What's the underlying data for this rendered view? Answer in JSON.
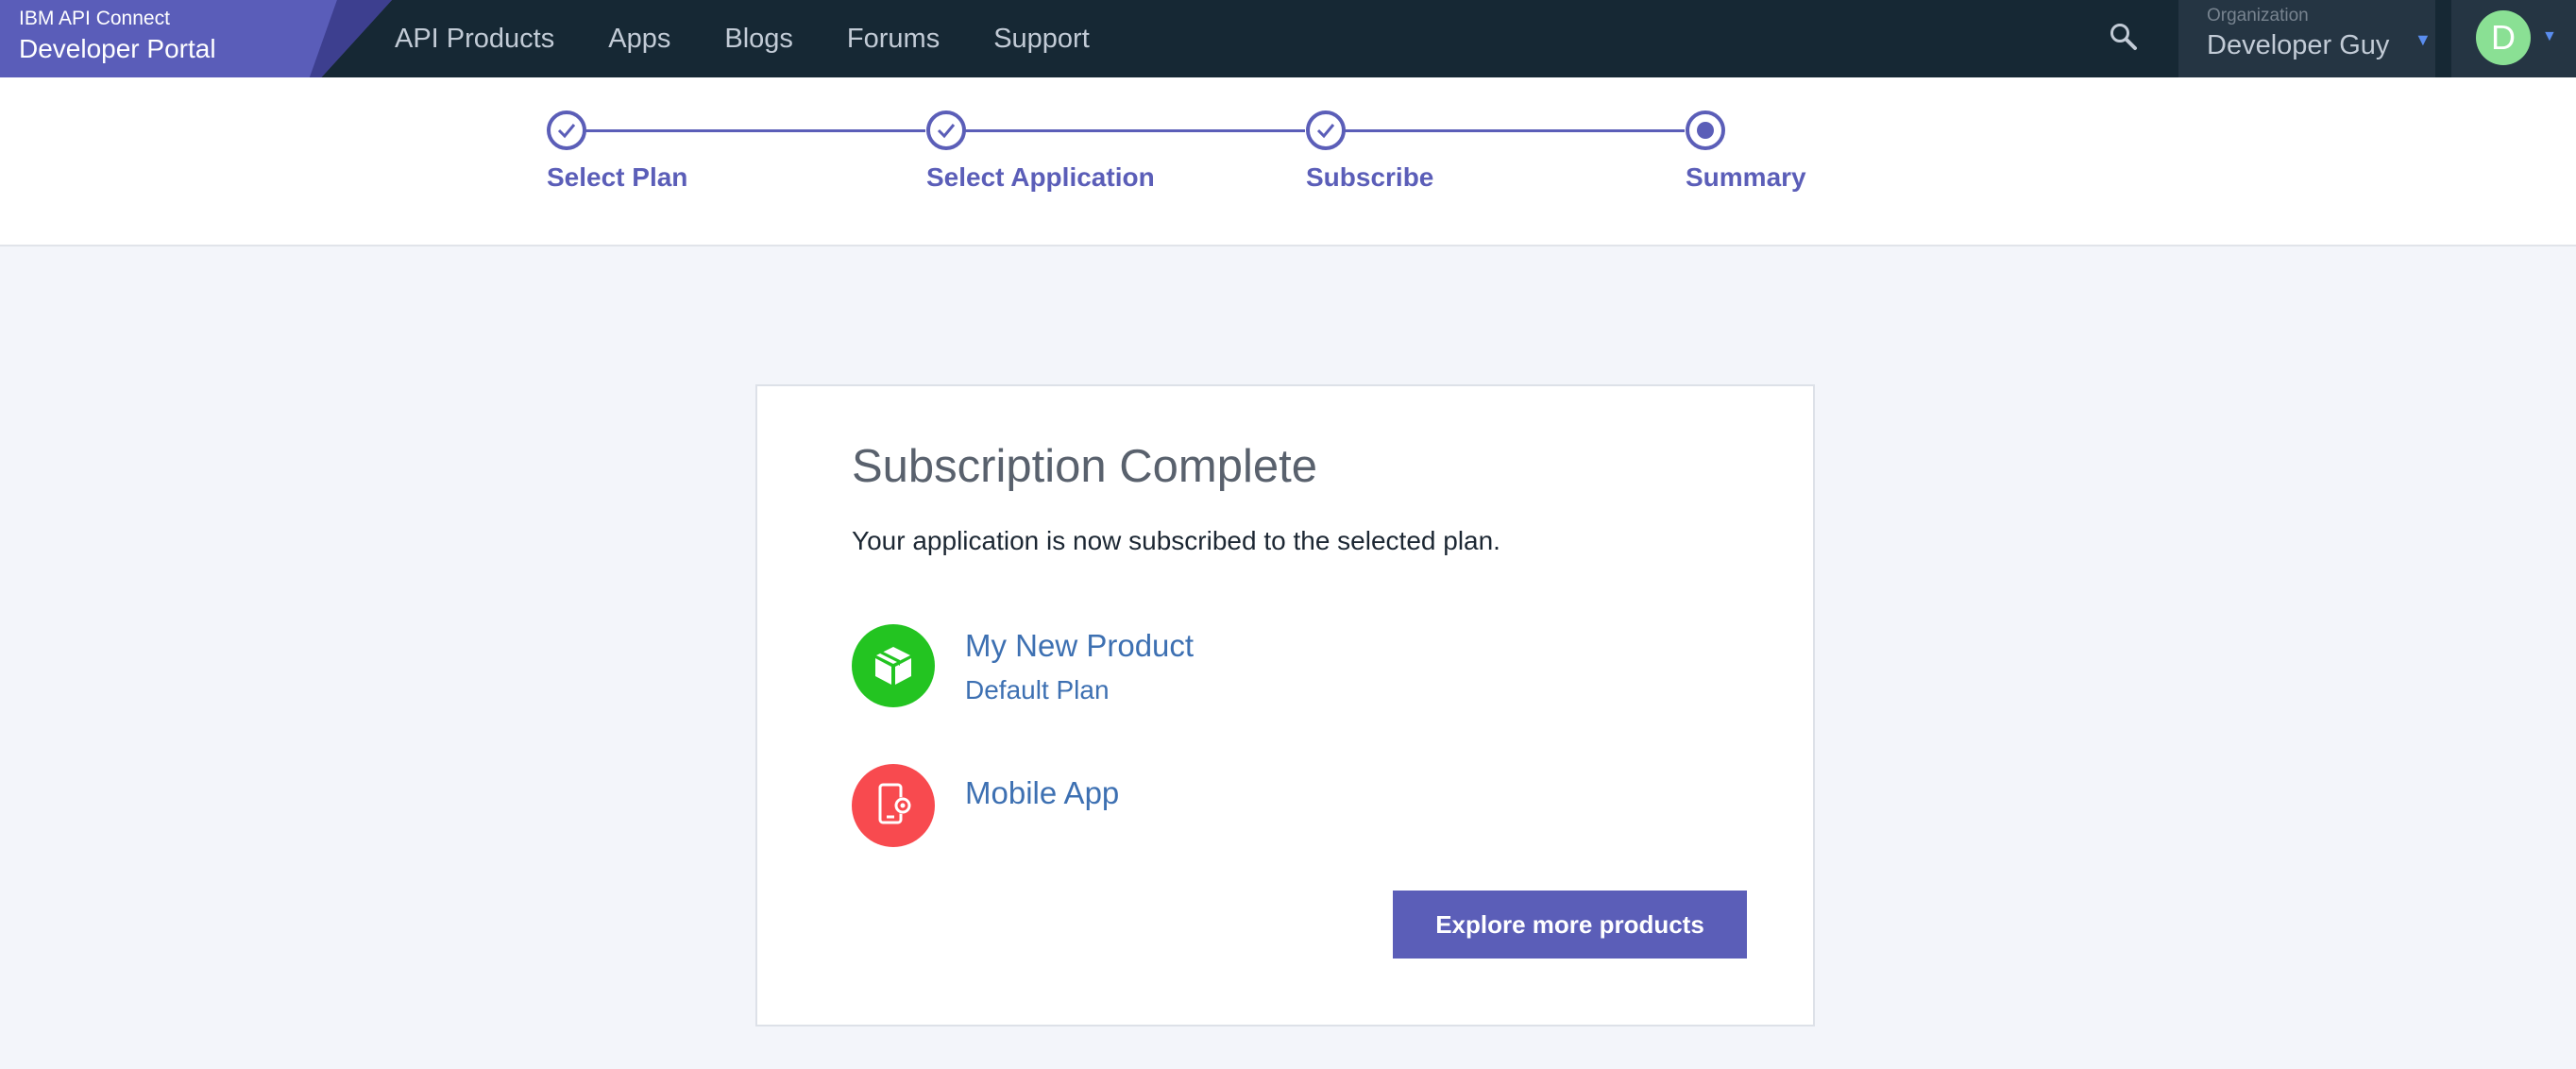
{
  "brand": {
    "small": "IBM API Connect",
    "big": "Developer Portal",
    "color": "#5a5db9"
  },
  "nav": {
    "items": [
      "API Products",
      "Apps",
      "Blogs",
      "Forums",
      "Support"
    ]
  },
  "header": {
    "org_label": "Organization",
    "org_name": "Developer Guy",
    "avatar_initial": "D",
    "avatar_color": "#8ae094"
  },
  "steps": [
    {
      "label": "Select Plan",
      "state": "done"
    },
    {
      "label": "Select Application",
      "state": "done"
    },
    {
      "label": "Subscribe",
      "state": "done"
    },
    {
      "label": "Summary",
      "state": "current"
    }
  ],
  "card": {
    "title": "Subscription Complete",
    "subtitle": "Your application is now subscribed to the selected plan.",
    "product": {
      "name": "My New Product",
      "plan": "Default Plan",
      "icon": "package-icon",
      "color": "#23c421"
    },
    "app": {
      "name": "Mobile App",
      "icon": "mobile-app-icon",
      "color": "#f84a4f"
    },
    "button": "Explore more products"
  },
  "colors": {
    "accent": "#5b5eb8",
    "link": "#3d70b2",
    "topbar": "#162834"
  }
}
